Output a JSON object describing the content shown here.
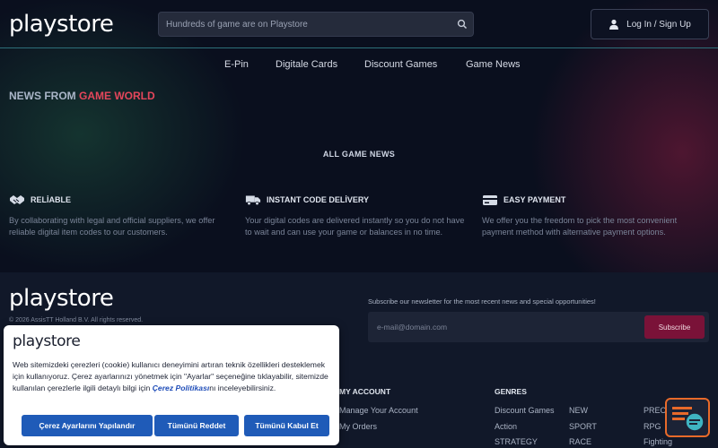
{
  "header": {
    "logo": "playstore",
    "search_placeholder": "Hundreds of game are on Playstore",
    "login_label": "Log In / Sign Up"
  },
  "nav": {
    "items": [
      "E-Pin",
      "Digitale Cards",
      "Discount Games",
      "Game News"
    ]
  },
  "news": {
    "heading_prefix": "NEWS FROM",
    "heading_accent": "GAME WORLD",
    "all_news": "ALL GAME NEWS"
  },
  "features": [
    {
      "title": "RELİABLE",
      "description": "By collaborating with legal and official suppliers, we offer reliable digital item codes to our customers.",
      "icon": "handshake-icon"
    },
    {
      "title": "INSTANT CODE DELİVERY",
      "description": "Your digital codes are delivered instantly so you do not have to wait and can use your game or balances in no time.",
      "icon": "truck-icon"
    },
    {
      "title": "EASY PAYMENT",
      "description": "We offer you the freedom to pick the most convenient payment method with alternative payment options.",
      "icon": "credit-card-icon"
    }
  ],
  "footer": {
    "logo": "playstore",
    "copyright": "© 2026 AssisTT Holland B.V. All rights reserved.",
    "newsletter_text": "Subscribe our newsletter for the most recent news and special opportunities!",
    "email_placeholder": "e-mail@domain.com",
    "subscribe_label": "Subscribe",
    "my_account": {
      "title": "MY ACCOUNT",
      "links": [
        "Manage Your Account",
        "My Orders"
      ]
    },
    "genres": {
      "title": "GENRES",
      "col1": [
        "Discount Games",
        "Action",
        "STRATEGY"
      ],
      "col2": [
        "NEW",
        "SPORT",
        "RACE"
      ],
      "col3": [
        "PREORDER",
        "RPG",
        "Fighting"
      ]
    }
  },
  "cookie": {
    "logo": "playstore",
    "text_before": "Web sitemizdeki çerezleri (cookie) kullanıcı deneyimini artıran teknik özellikleri desteklemek için kullanıyoruz. Çerez ayarlarınızı yönetmek için \"Ayarlar\" seçeneğine tıklayabilir, sitemizde kullanılan çerezlerle ilgili detaylı bilgi için ",
    "policy_link": "Çerez Politikası",
    "text_after": "nı inceleyebilirsiniz.",
    "btn_settings": "Çerez Ayarlarını Yapılandır",
    "btn_reject": "Tümünü Reddet",
    "btn_accept": "Tümünü Kabul Et"
  },
  "colors": {
    "accent": "#e4465b",
    "button_blue": "#1f5bb8",
    "subscribe": "#7a1238"
  }
}
